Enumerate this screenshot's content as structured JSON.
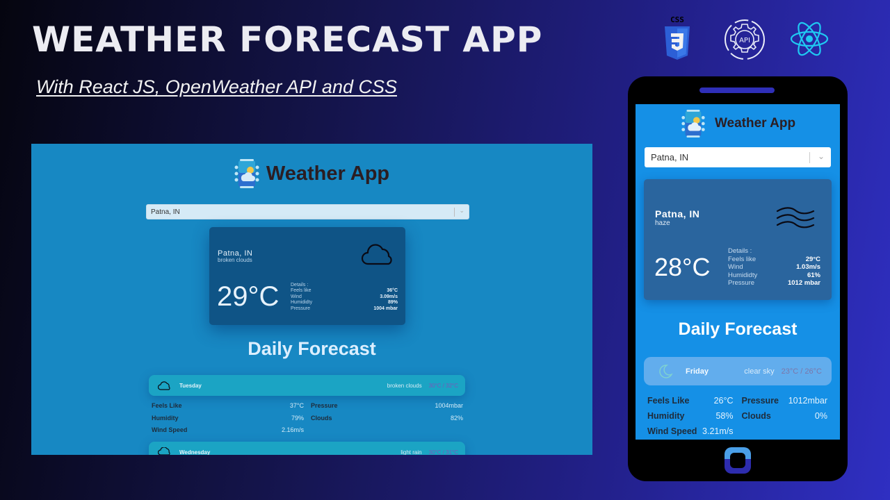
{
  "banner": {
    "title": "WEATHER FORECAST APP",
    "subtitle": "With  React JS, OpenWeather API and CSS "
  },
  "tech_icons": [
    {
      "name": "css3-icon",
      "label": "CSS"
    },
    {
      "name": "api-gear-icon",
      "label": "API"
    },
    {
      "name": "react-icon",
      "label": ""
    }
  ],
  "desktop": {
    "app_title": "Weather App",
    "search": {
      "value": "Patna, IN"
    },
    "current": {
      "city": "Patna, IN",
      "description": "broken clouds",
      "icon": "cloud-icon",
      "temperature": "29°C",
      "details_label": "Details :",
      "details": [
        {
          "label": "Feels like",
          "value": "36°C"
        },
        {
          "label": "Wind",
          "value": "3.09m/s"
        },
        {
          "label": "Humididty",
          "value": "89%"
        },
        {
          "label": "Pressure",
          "value": "1004 mbar"
        }
      ]
    },
    "forecast_title": "Daily Forecast",
    "forecast": [
      {
        "day": "Tuesday",
        "description": "broken clouds",
        "minmax": "30°C / 32°C",
        "icon": "cloud-icon"
      },
      {
        "day": "Wednesday",
        "description": "light rain",
        "minmax": "30°C / 31°C",
        "icon": "cloud-rain-icon"
      }
    ],
    "expanded": [
      {
        "label": "Feels Like",
        "value": "37°C"
      },
      {
        "label": "Pressure",
        "value": "1004mbar"
      },
      {
        "label": "Humidity",
        "value": "79%"
      },
      {
        "label": "Clouds",
        "value": "82%"
      },
      {
        "label": "Wind Speed",
        "value": "2.16m/s"
      }
    ]
  },
  "mobile": {
    "app_title": "Weather App",
    "search": {
      "value": "Patna, IN"
    },
    "current": {
      "city": "Patna, IN",
      "description": "haze",
      "icon": "haze-icon",
      "temperature": "28°C",
      "details_label": "Details :",
      "details": [
        {
          "label": "Feels like",
          "value": "29°C"
        },
        {
          "label": "Wind",
          "value": "1.03m/s"
        },
        {
          "label": "Humididty",
          "value": "61%"
        },
        {
          "label": "Pressure",
          "value": "1012 mbar"
        }
      ]
    },
    "forecast_title": "Daily Forecast",
    "forecast": [
      {
        "day": "Friday",
        "description": "clear sky",
        "minmax": "23°C / 26°C",
        "icon": "moon-icon"
      }
    ],
    "expanded": [
      {
        "label": "Feels Like",
        "value": "26°C"
      },
      {
        "label": "Pressure",
        "value": "1012mbar"
      },
      {
        "label": "Humidity",
        "value": "58%"
      },
      {
        "label": "Clouds",
        "value": "0%"
      },
      {
        "label": "Wind Speed",
        "value": "3.21m/s"
      }
    ]
  },
  "colors": {
    "desktop_bg": "#1788c3",
    "desktop_card": "#0f5486",
    "desktop_item": "#1ba4c4",
    "mobile_bg": "#1590e6",
    "mobile_card": "#2a659e",
    "mobile_item": "#62aded"
  }
}
